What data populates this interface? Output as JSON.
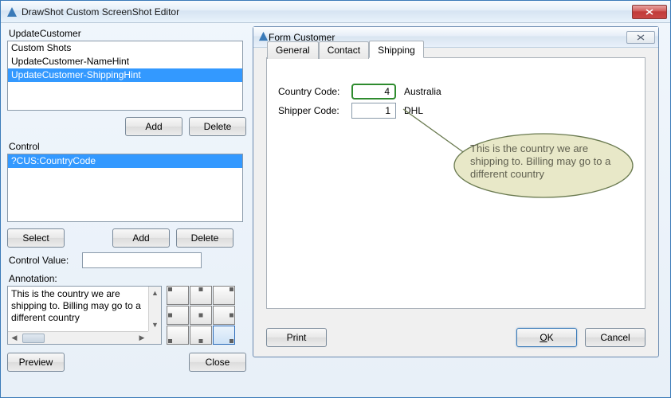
{
  "window": {
    "title": "DrawShot Custom ScreenShot Editor"
  },
  "left": {
    "updateCustomerLabel": "UpdateCustomer",
    "shots": {
      "header": "Custom Shots",
      "items": [
        "UpdateCustomer-NameHint",
        "UpdateCustomer-ShippingHint"
      ]
    },
    "addLabel": "Add",
    "deleteLabel": "Delete",
    "controlHeader": "Control",
    "controlItems": [
      "?CUS:CountryCode"
    ],
    "selectLabel": "Select",
    "controlValueLabel": "Control Value:",
    "controlValue": "",
    "annotationLabel": "Annotation:",
    "annotationText": "This is the country we are shipping to. Billing may go to a different country",
    "previewLabel": "Preview",
    "closeLabel": "Close"
  },
  "form": {
    "title": "Form Customer",
    "tabs": [
      "General",
      "Contact",
      "Shipping"
    ],
    "activeTab": 2,
    "countryCodeLabel": "Country Code:",
    "countryCodeValue": "4",
    "countryName": "Australia",
    "shipperCodeLabel": "Shipper Code:",
    "shipperCodeValue": "1",
    "shipperName": "DHL",
    "callout": "This is the country we are shipping to. Billing may go to a different country",
    "printLabel": "Print",
    "okLabel": "OK",
    "cancelLabel": "Cancel"
  }
}
